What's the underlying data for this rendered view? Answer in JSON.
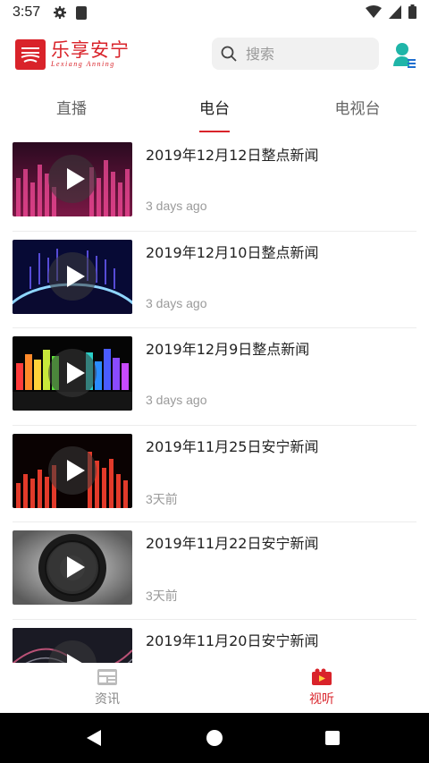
{
  "status_bar": {
    "time": "3:57"
  },
  "header": {
    "logo_cn": "乐享安宁",
    "logo_en": "Lexiang Anning",
    "search_placeholder": "搜索"
  },
  "tabs": [
    {
      "label": "直播",
      "active": false
    },
    {
      "label": "电台",
      "active": true
    },
    {
      "label": "电视台",
      "active": false
    }
  ],
  "items": [
    {
      "title": "2019年12月12日整点新闻",
      "time": "3 days ago"
    },
    {
      "title": "2019年12月10日整点新闻",
      "time": "3 days ago"
    },
    {
      "title": "2019年12月9日整点新闻",
      "time": "3 days ago"
    },
    {
      "title": "2019年11月25日安宁新闻",
      "time": "3天前"
    },
    {
      "title": "2019年11月22日安宁新闻",
      "time": "3天前"
    },
    {
      "title": "2019年11月20日安宁新闻",
      "time": ""
    }
  ],
  "bottom_nav": [
    {
      "label": "资讯",
      "icon": "news-icon",
      "active": false
    },
    {
      "label": "视听",
      "icon": "video-icon",
      "active": true
    }
  ],
  "colors": {
    "accent": "#d9232a",
    "teal": "#1fb5a8"
  }
}
